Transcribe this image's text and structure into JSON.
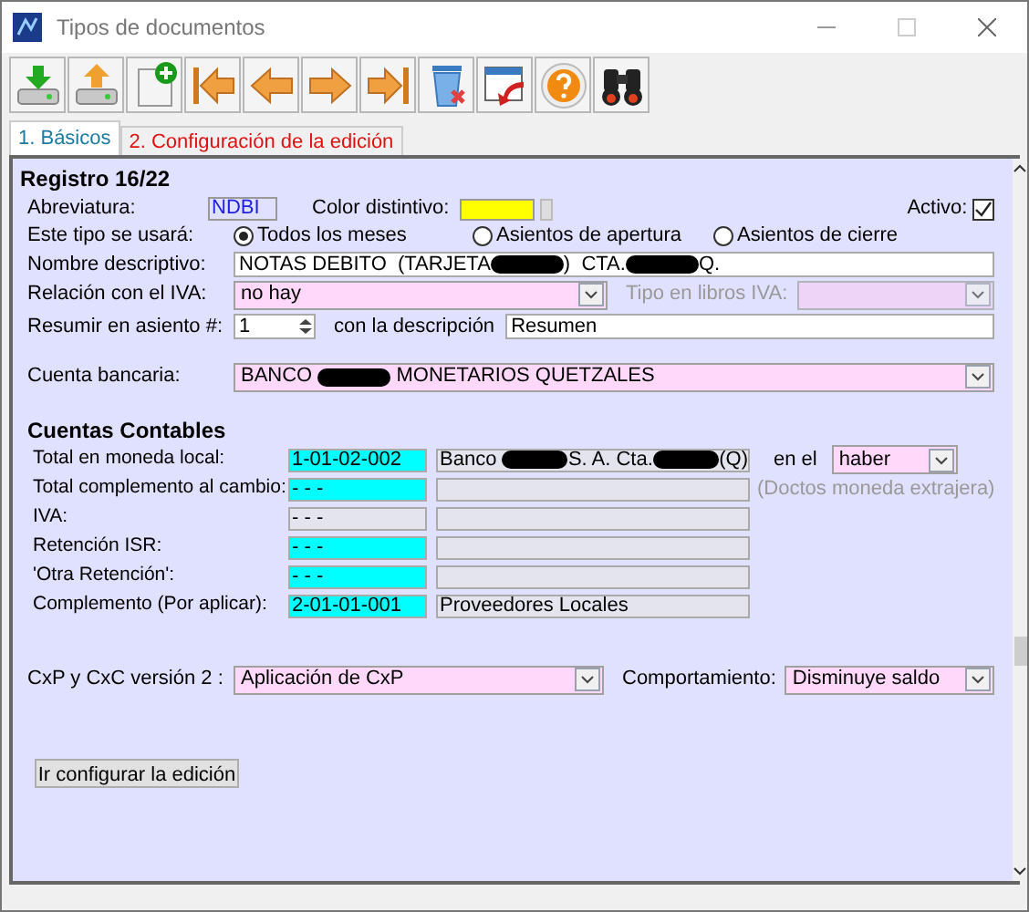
{
  "window": {
    "title": "Tipos de documentos"
  },
  "toolbar": [
    {
      "kind": "save"
    },
    {
      "kind": "upload"
    },
    {
      "kind": "new"
    },
    {
      "kind": "first"
    },
    {
      "kind": "prev"
    },
    {
      "kind": "next"
    },
    {
      "kind": "last"
    },
    {
      "kind": "delete"
    },
    {
      "kind": "undo"
    },
    {
      "kind": "help"
    },
    {
      "kind": "find"
    }
  ],
  "tabs": [
    {
      "label": "1. Básicos",
      "selected": true
    },
    {
      "label": "2. Configuración de la edición",
      "selected": false
    }
  ],
  "record": "Registro 16/22",
  "abbreviation": {
    "label": "Abreviatura:",
    "value": "NDBI"
  },
  "color": {
    "label": "Color distintivo:",
    "color": "#ffff00"
  },
  "active": {
    "label": "Activo:",
    "checked": true
  },
  "usage": {
    "label": "Este tipo se usará:",
    "options": [
      {
        "label": "Todos los meses",
        "selected": true
      },
      {
        "label": "Asientos de apertura",
        "selected": false
      },
      {
        "label": "Asientos de cierre",
        "selected": false
      }
    ]
  },
  "name": {
    "label": "Nombre descriptivo:",
    "parts": [
      {
        "kind": "text",
        "text": "NOTAS DEBITO  (TARJETA"
      },
      {
        "kind": "redacted"
      },
      {
        "kind": "text",
        "text": ")  CTA."
      },
      {
        "kind": "redacted"
      },
      {
        "kind": "text",
        "text": "Q."
      }
    ]
  },
  "iva_relation": {
    "label": "Relación con el IVA:",
    "value": "no hay"
  },
  "iva_books": {
    "label": "Tipo en libros IVA:",
    "disabled": true
  },
  "summarize": {
    "label": "Resumir en asiento #:",
    "value": "1",
    "description_label": "con la descripción",
    "description": "Resumen"
  },
  "bank_account": {
    "label": "Cuenta bancaria:",
    "parts": [
      {
        "kind": "text",
        "text": "BANCO "
      },
      {
        "kind": "redacted"
      },
      {
        "kind": "text",
        "text": " MONETARIOS QUETZALES"
      }
    ]
  },
  "accounts": {
    "title": "Cuentas Contables",
    "rows": [
      {
        "label": "Total en moneda local:",
        "code": "1-01-02-002",
        "highlighted": true,
        "description": [
          {
            "kind": "text",
            "text": "Banco "
          },
          {
            "kind": "redacted"
          },
          {
            "kind": "text",
            "text": "S. A. Cta."
          },
          {
            "kind": "redacted"
          },
          {
            "kind": "text",
            "text": "(Q)"
          }
        ],
        "extra": {
          "kind": "side",
          "label": "en el",
          "value": "haber"
        }
      },
      {
        "label": "Total complemento al cambio:",
        "code": "- - -",
        "highlighted": true,
        "extra": {
          "kind": "note",
          "text": "(Doctos moneda extrajera)"
        }
      },
      {
        "label": "IVA:",
        "code": "- - -",
        "highlighted": false
      },
      {
        "label": "Retención ISR:",
        "code": "- - -",
        "highlighted": true
      },
      {
        "label": "'Otra Retención':",
        "code": "- - -",
        "highlighted": true
      },
      {
        "label": "Complemento (Por aplicar):",
        "code": "2-01-01-001",
        "highlighted": true,
        "description": [
          {
            "kind": "text",
            "text": "Proveedores Locales"
          }
        ]
      }
    ]
  },
  "cxp": {
    "label": "CxP y CxC versión 2 :",
    "value": "Aplicación de CxP",
    "behavior_label": "Comportamiento:",
    "behavior": "Disminuye saldo"
  },
  "configure_button": "Ir configurar la edición"
}
